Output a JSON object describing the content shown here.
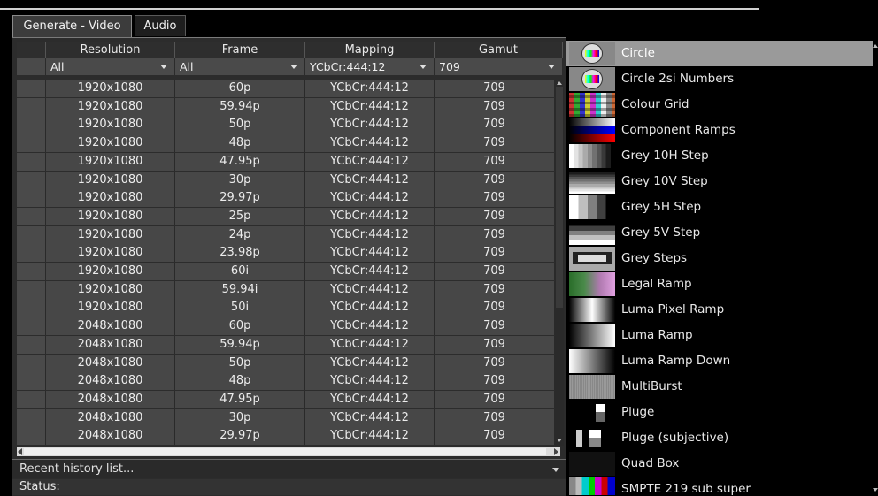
{
  "tabs": [
    {
      "label": "Generate - Video",
      "active": true
    },
    {
      "label": "Audio",
      "active": false
    }
  ],
  "columns": [
    "Resolution",
    "Frame",
    "Mapping",
    "Gamut"
  ],
  "filters": {
    "resolution": "All",
    "frame": "All",
    "mapping": "YCbCr:444:12",
    "gamut": "709"
  },
  "rows": [
    [
      "1920x1080",
      "60p",
      "YCbCr:444:12",
      "709"
    ],
    [
      "1920x1080",
      "59.94p",
      "YCbCr:444:12",
      "709"
    ],
    [
      "1920x1080",
      "50p",
      "YCbCr:444:12",
      "709"
    ],
    [
      "1920x1080",
      "48p",
      "YCbCr:444:12",
      "709"
    ],
    [
      "1920x1080",
      "47.95p",
      "YCbCr:444:12",
      "709"
    ],
    [
      "1920x1080",
      "30p",
      "YCbCr:444:12",
      "709"
    ],
    [
      "1920x1080",
      "29.97p",
      "YCbCr:444:12",
      "709"
    ],
    [
      "1920x1080",
      "25p",
      "YCbCr:444:12",
      "709"
    ],
    [
      "1920x1080",
      "24p",
      "YCbCr:444:12",
      "709"
    ],
    [
      "1920x1080",
      "23.98p",
      "YCbCr:444:12",
      "709"
    ],
    [
      "1920x1080",
      "60i",
      "YCbCr:444:12",
      "709"
    ],
    [
      "1920x1080",
      "59.94i",
      "YCbCr:444:12",
      "709"
    ],
    [
      "1920x1080",
      "50i",
      "YCbCr:444:12",
      "709"
    ],
    [
      "2048x1080",
      "60p",
      "YCbCr:444:12",
      "709"
    ],
    [
      "2048x1080",
      "59.94p",
      "YCbCr:444:12",
      "709"
    ],
    [
      "2048x1080",
      "50p",
      "YCbCr:444:12",
      "709"
    ],
    [
      "2048x1080",
      "48p",
      "YCbCr:444:12",
      "709"
    ],
    [
      "2048x1080",
      "47.95p",
      "YCbCr:444:12",
      "709"
    ],
    [
      "2048x1080",
      "30p",
      "YCbCr:444:12",
      "709"
    ],
    [
      "2048x1080",
      "29.97p",
      "YCbCr:444:12",
      "709"
    ]
  ],
  "history_label": "Recent history list...",
  "status_label": "Status:",
  "patterns": [
    {
      "label": "Circle",
      "icon": "circle-thumb",
      "selected": true
    },
    {
      "label": "Circle 2si Numbers",
      "icon": "circle-numbers-thumb",
      "selected": false
    },
    {
      "label": "Colour Grid",
      "icon": "colour-grid-thumb",
      "selected": false
    },
    {
      "label": "Component Ramps",
      "icon": "component-ramps-thumb",
      "selected": false
    },
    {
      "label": "Grey 10H Step",
      "icon": "grey-10h-step-thumb",
      "selected": false
    },
    {
      "label": "Grey 10V Step",
      "icon": "grey-10v-step-thumb",
      "selected": false
    },
    {
      "label": "Grey 5H Step",
      "icon": "grey-5h-step-thumb",
      "selected": false
    },
    {
      "label": "Grey 5V Step",
      "icon": "grey-5v-step-thumb",
      "selected": false
    },
    {
      "label": "Grey Steps",
      "icon": "grey-steps-thumb",
      "selected": false
    },
    {
      "label": "Legal Ramp",
      "icon": "legal-ramp-thumb",
      "selected": false
    },
    {
      "label": "Luma Pixel Ramp",
      "icon": "luma-pixel-ramp-thumb",
      "selected": false
    },
    {
      "label": "Luma Ramp",
      "icon": "luma-ramp-thumb",
      "selected": false
    },
    {
      "label": "Luma Ramp Down",
      "icon": "luma-ramp-down-thumb",
      "selected": false
    },
    {
      "label": "MultiBurst",
      "icon": "multiburst-thumb",
      "selected": false
    },
    {
      "label": "Pluge",
      "icon": "pluge-thumb",
      "selected": false
    },
    {
      "label": "Pluge (subjective)",
      "icon": "pluge-subjective-thumb",
      "selected": false
    },
    {
      "label": "Quad Box",
      "icon": "quad-box-thumb",
      "selected": false
    },
    {
      "label": "SMPTE 219 sub super",
      "icon": "smpte-219-thumb",
      "selected": false
    }
  ],
  "colors": {
    "background": "#000000",
    "panel": "#2c2c2c",
    "cell": "#474747",
    "selected_row": "#9a9a9a"
  }
}
